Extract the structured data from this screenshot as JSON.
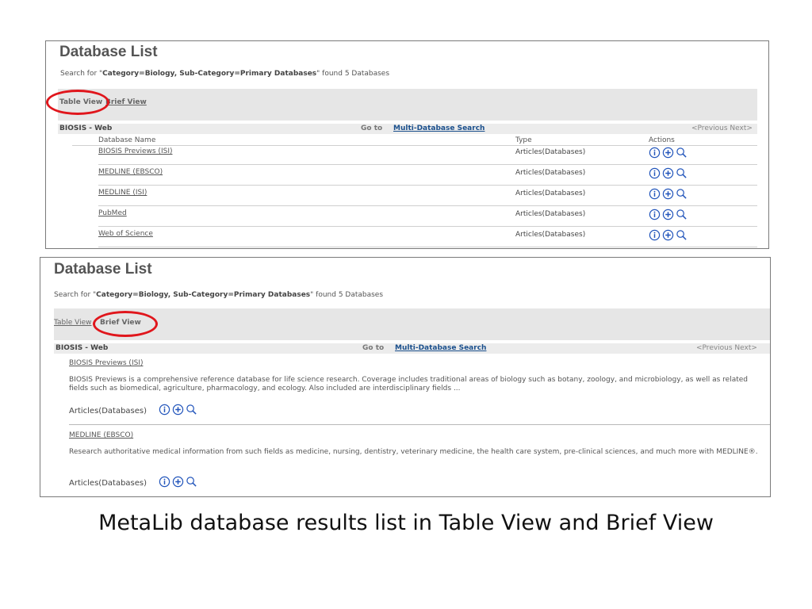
{
  "caption": "MetaLib database results list in Table View and Brief View",
  "table_view": {
    "title": "Database List",
    "search": {
      "prefix": "Search for \"",
      "query": "Category=Biology, Sub-Category=Primary Databases",
      "suffix": "\" found 5 Databases"
    },
    "views": {
      "table": "Table View",
      "brief": "Brief View"
    },
    "group": "BIOSIS - Web",
    "goto_label": "Go to",
    "multi_search": "Multi-Database Search",
    "pager": "<Previous Next>",
    "columns": {
      "name": "Database Name",
      "type": "Type",
      "actions": "Actions"
    },
    "rows": [
      {
        "name": "BIOSIS Previews (ISI)",
        "type": "Articles(Databases)"
      },
      {
        "name": "MEDLINE (EBSCO)",
        "type": "Articles(Databases)"
      },
      {
        "name": "MEDLINE (ISI)",
        "type": "Articles(Databases)"
      },
      {
        "name": "PubMed",
        "type": "Articles(Databases)"
      },
      {
        "name": "Web of Science",
        "type": "Articles(Databases)"
      }
    ],
    "icons": [
      "info-icon",
      "add-icon",
      "search-icon"
    ]
  },
  "brief_view": {
    "title": "Database List",
    "search": {
      "prefix": "Search for \"",
      "query": "Category=Biology, Sub-Category=Primary Databases",
      "suffix": "\" found 5 Databases"
    },
    "views": {
      "table": "Table View",
      "brief": "Brief View"
    },
    "group": "BIOSIS - Web",
    "goto_label": "Go to",
    "multi_search": "Multi-Database Search",
    "pager": "<Previous Next>",
    "items": [
      {
        "name": "BIOSIS Previews (ISI)",
        "description": "BIOSIS Previews is a comprehensive reference database for life science research. Coverage includes traditional areas of biology such as botany, zoology, and microbiology, as well as related fields such as biomedical, agriculture, pharmacology, and ecology. Also included are interdisciplinary fields ...",
        "type": "Articles(Databases)"
      },
      {
        "name": "MEDLINE (EBSCO)",
        "description": "Research authoritative medical information from such fields as medicine, nursing, dentistry, veterinary medicine, the health care system, pre-clinical sciences, and much more with MEDLINE®.",
        "type": "Articles(Databases)"
      }
    ]
  },
  "colors": {
    "highlight": "#e0161c",
    "link": "#1a4f8c",
    "bar": "#e6e6e6",
    "icon": "#2255bb"
  }
}
